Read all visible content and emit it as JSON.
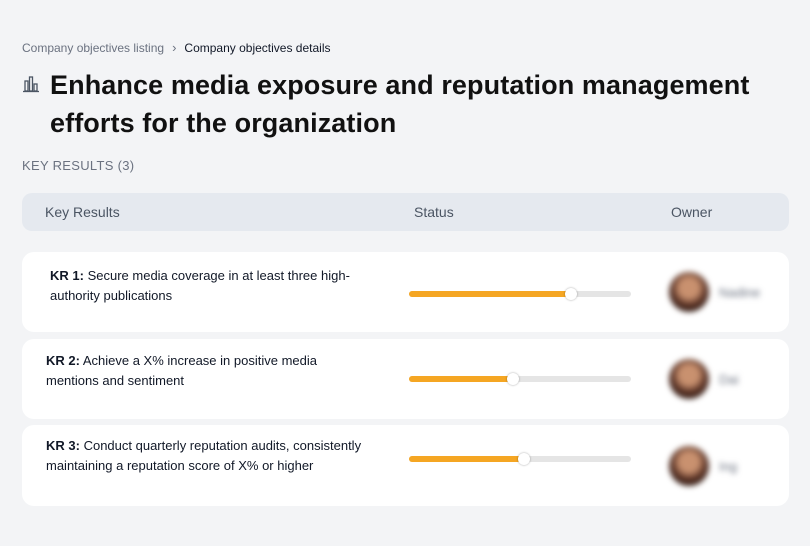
{
  "breadcrumb": {
    "parent": "Company objectives listing",
    "separator": "›",
    "current": "Company objectives details"
  },
  "objective": {
    "icon": "building-chart-icon",
    "title": "Enhance media exposure and reputation management efforts for the organization"
  },
  "key_results_section": {
    "label": "KEY RESULTS (3)"
  },
  "table": {
    "headers": {
      "key_results": "Key Results",
      "status": "Status",
      "owner": "Owner"
    },
    "rows": [
      {
        "id": "KR 1:",
        "text": "Secure media coverage in at least three high-authority publications",
        "progress_percent": 73,
        "owner": "Nadine"
      },
      {
        "id": "KR 2:",
        "text": "Achieve a X% increase in positive media mentions and sentiment",
        "progress_percent": 47,
        "owner": "Dai"
      },
      {
        "id": "KR 3:",
        "text": "Conduct quarterly reputation audits, consistently maintaining a reputation score of X% or higher",
        "progress_percent": 52,
        "owner": "Ing"
      }
    ]
  },
  "colors": {
    "progress": "#f5a623",
    "track": "#e5e5e5",
    "background": "#f3f4f6",
    "header_bg": "#e5e9ef"
  }
}
